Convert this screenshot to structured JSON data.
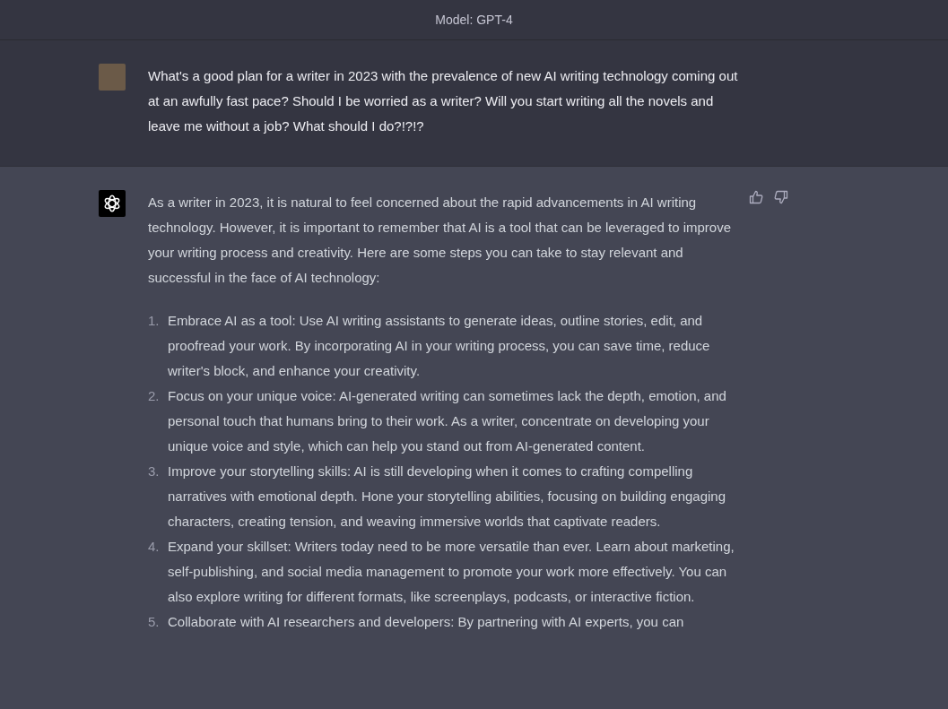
{
  "header": {
    "title": "Model: GPT-4"
  },
  "messages": [
    {
      "kind": "user",
      "text": "What's a good plan for a writer in 2023 with the prevalence of new AI writing technology coming out at an awfully fast pace? Should I be worried as a writer? Will you start writing all the novels and leave me without a job? What should I do?!?!?"
    },
    {
      "kind": "assistant",
      "text": "As a writer in 2023, it is natural to feel concerned about the rapid advancements in AI writing technology. However, it is important to remember that AI is a tool that can be leveraged to improve your writing process and creativity. Here are some steps you can take to stay relevant and successful in the face of AI technology:",
      "list": [
        {
          "number": "1.",
          "text": "Embrace AI as a tool: Use AI writing assistants to generate ideas, outline stories, edit, and proofread your work. By incorporating AI in your writing process, you can save time, reduce writer's block, and enhance your creativity."
        },
        {
          "number": "2.",
          "text": "Focus on your unique voice: AI-generated writing can sometimes lack the depth, emotion, and personal touch that humans bring to their work. As a writer, concentrate on developing your unique voice and style, which can help you stand out from AI-generated content."
        },
        {
          "number": "3.",
          "text": "Improve your storytelling skills: AI is still developing when it comes to crafting compelling narratives with emotional depth. Hone your storytelling abilities, focusing on building engaging characters, creating tension, and weaving immersive worlds that captivate readers."
        },
        {
          "number": "4.",
          "text": "Expand your skillset: Writers today need to be more versatile than ever. Learn about marketing, self-publishing, and social media management to promote your work more effectively. You can also explore writing for different formats, like screenplays, podcasts, or interactive fiction."
        },
        {
          "number": "5.",
          "text": "Collaborate with AI researchers and developers: By partnering with AI experts, you can"
        }
      ]
    }
  ]
}
